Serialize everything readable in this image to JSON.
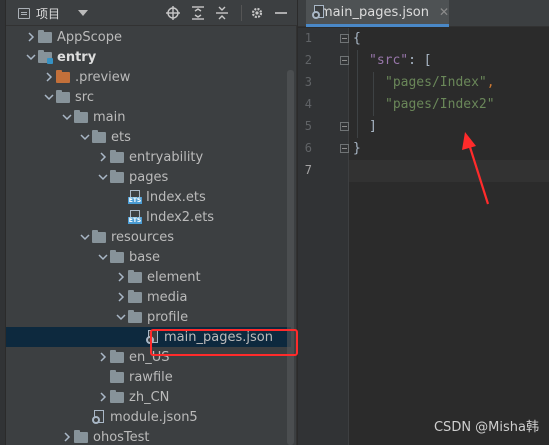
{
  "project_panel": {
    "title": "项目",
    "tree": [
      {
        "label": "AppScope",
        "depth": 0,
        "expanded": false,
        "type": "folder"
      },
      {
        "label": "entry",
        "depth": 0,
        "expanded": true,
        "type": "module",
        "bold": true
      },
      {
        "label": ".preview",
        "depth": 1,
        "expanded": false,
        "type": "folder-orange"
      },
      {
        "label": "src",
        "depth": 1,
        "expanded": true,
        "type": "folder"
      },
      {
        "label": "main",
        "depth": 2,
        "expanded": true,
        "type": "folder"
      },
      {
        "label": "ets",
        "depth": 3,
        "expanded": true,
        "type": "folder"
      },
      {
        "label": "entryability",
        "depth": 4,
        "expanded": false,
        "type": "folder"
      },
      {
        "label": "pages",
        "depth": 4,
        "expanded": true,
        "type": "folder"
      },
      {
        "label": "Index.ets",
        "depth": 5,
        "type": "ets"
      },
      {
        "label": "Index2.ets",
        "depth": 5,
        "type": "ets"
      },
      {
        "label": "resources",
        "depth": 3,
        "expanded": true,
        "type": "folder"
      },
      {
        "label": "base",
        "depth": 4,
        "expanded": true,
        "type": "folder"
      },
      {
        "label": "element",
        "depth": 5,
        "expanded": false,
        "type": "folder"
      },
      {
        "label": "media",
        "depth": 5,
        "expanded": false,
        "type": "folder"
      },
      {
        "label": "profile",
        "depth": 5,
        "expanded": true,
        "type": "folder"
      },
      {
        "label": "main_pages.json",
        "depth": 6,
        "type": "json",
        "selected": true
      },
      {
        "label": "en_US",
        "depth": 4,
        "expanded": false,
        "type": "folder"
      },
      {
        "label": "rawfile",
        "depth": 4,
        "type": "folder-noarrow"
      },
      {
        "label": "zh_CN",
        "depth": 4,
        "expanded": false,
        "type": "folder"
      },
      {
        "label": "module.json5",
        "depth": 3,
        "type": "json"
      },
      {
        "label": "ohosTest",
        "depth": 2,
        "expanded": false,
        "type": "folder"
      }
    ]
  },
  "editor": {
    "tab_label": "main_pages.json",
    "line_numbers": [
      "1",
      "2",
      "3",
      "4",
      "5",
      "6",
      "7"
    ],
    "code": {
      "l1_open": "{",
      "l2_key": "\"src\"",
      "l2_colon": ": ",
      "l2_bracket": "[",
      "l3_str": "\"pages/Index\"",
      "l3_comma": ",",
      "l4_str": "\"pages/Index2\"",
      "l5_bracket": "]",
      "l6_close": "}"
    }
  },
  "watermark": "CSDN @Misha韩",
  "colors": {
    "highlight_box": "#ff2b2b",
    "arrow": "#ff2b2b",
    "selection": "#0d293e",
    "string": "#6a8759",
    "key": "#9876aa"
  }
}
